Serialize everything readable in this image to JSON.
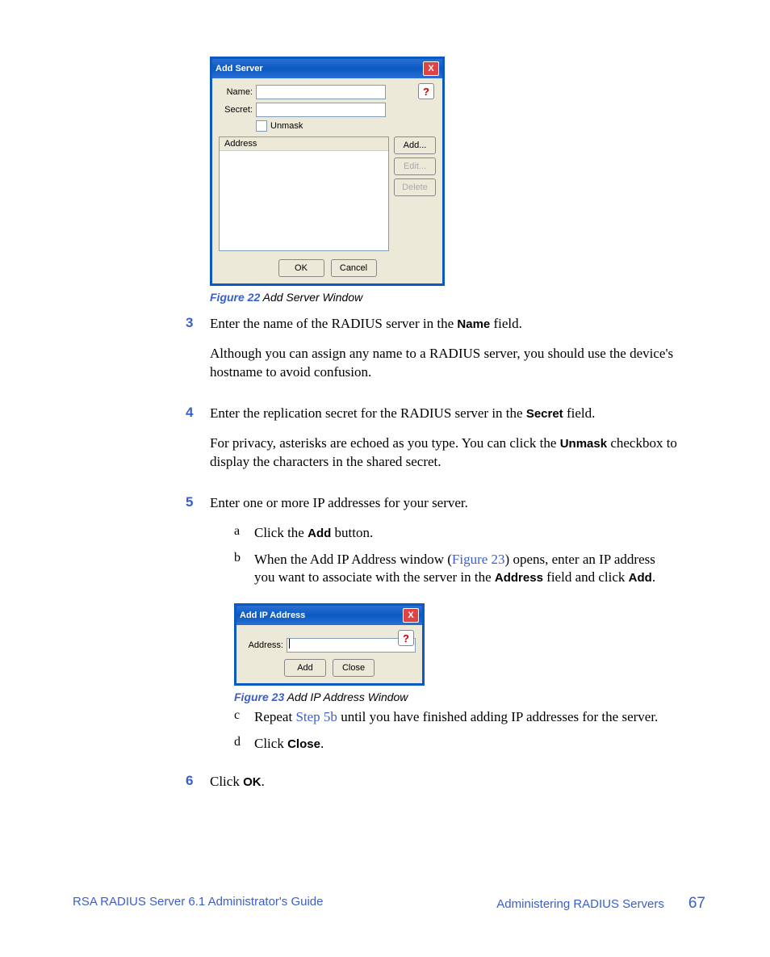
{
  "fig22": {
    "title": "Add Server",
    "nameLabel": "Name:",
    "secretLabel": "Secret:",
    "unmaskLabel": "Unmask",
    "addressHeader": "Address",
    "addBtn": "Add...",
    "editBtn": "Edit...",
    "deleteBtn": "Delete",
    "okBtn": "OK",
    "cancelBtn": "Cancel",
    "help": "?",
    "close": "X"
  },
  "cap22": {
    "num": "Figure 22",
    "txt": " Add Server Window"
  },
  "s3num": "3",
  "s3a": "Enter the name of the RADIUS server in the ",
  "s3b": "Name",
  "s3c": " field.",
  "s3p2": "Although you can assign any name to a RADIUS server, you should use the device's hostname to avoid confusion.",
  "s4num": "4",
  "s4a": "Enter the replication secret for the RADIUS server in the ",
  "s4b": "Secret",
  "s4c": " field.",
  "s4p2a": "For privacy, asterisks are echoed as you type. You can click the ",
  "s4p2b": "Unmask",
  "s4p2c": " checkbox to display the characters in the shared secret.",
  "s5num": "5",
  "s5": "Enter one or more IP addresses for your server.",
  "s5a_l": "a",
  "s5a_t1": "Click the ",
  "s5a_t2": "Add",
  "s5a_t3": " button.",
  "s5b_l": "b",
  "s5b_t1": "When the Add IP Address window (",
  "s5b_link": "Figure 23",
  "s5b_t2": ") opens, enter an IP address you want to associate with the server in the ",
  "s5b_t3": "Address",
  "s5b_t4": " field and click ",
  "s5b_t5": "Add",
  "s5b_t6": ".",
  "fig23": {
    "title": "Add IP Address",
    "addrLabel": "Address:",
    "addBtn": "Add",
    "closeBtn": "Close",
    "help": "?",
    "close": "X"
  },
  "cap23": {
    "num": "Figure 23",
    "txt": " Add IP Address Window"
  },
  "s5c_l": "c",
  "s5c_t1": "Repeat ",
  "s5c_link": "Step 5b",
  "s5c_t2": " until you have finished adding IP addresses for the server.",
  "s5d_l": "d",
  "s5d_t1": "Click ",
  "s5d_t2": "Close",
  "s5d_t3": ".",
  "s6num": "6",
  "s6a": "Click ",
  "s6b": "OK",
  "s6c": ".",
  "footL": "RSA RADIUS Server 6.1 Administrator's Guide",
  "footR": "Administering RADIUS Servers",
  "pnum": "67"
}
